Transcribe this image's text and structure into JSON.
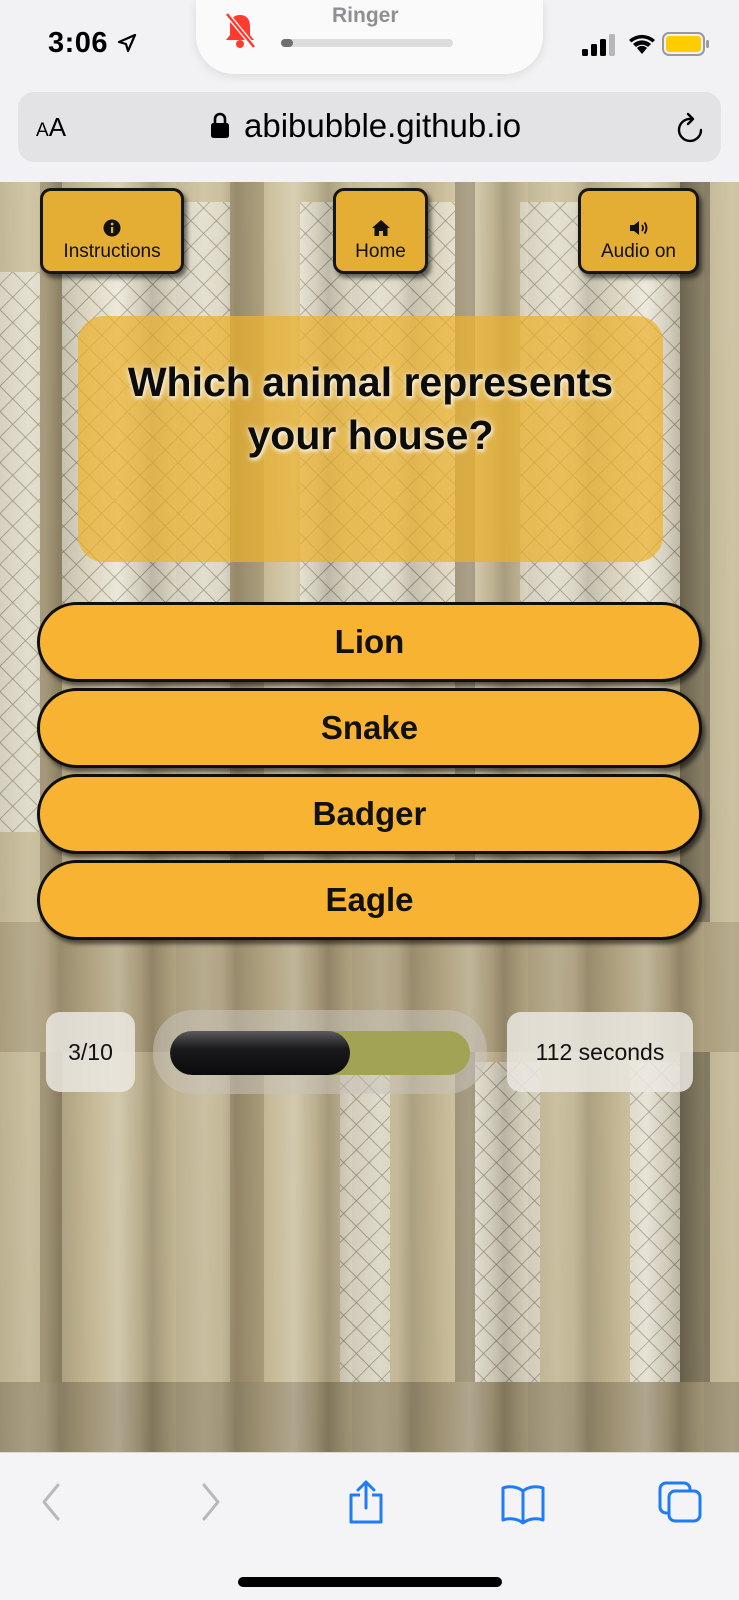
{
  "status_bar": {
    "time": "3:06",
    "ringer_label": "Ringer",
    "ringer_level": 0.07,
    "icons": [
      "location-arrow-icon",
      "bell-muted-icon",
      "signal-icon",
      "wifi-icon",
      "battery-icon"
    ]
  },
  "address_bar": {
    "text_size_label_small": "A",
    "text_size_label_large": "A",
    "url": "abibubble.github.io"
  },
  "nav": {
    "instructions_label": "Instructions",
    "home_label": "Home",
    "audio_label": "Audio on"
  },
  "quiz": {
    "question": "Which animal represents your house?",
    "answers": [
      "Lion",
      "Snake",
      "Badger",
      "Eagle"
    ],
    "counter": "3/10",
    "progress_fraction": 0.6,
    "timer": "112 seconds"
  },
  "colors": {
    "button": "#f7b331",
    "nav_button": "#e4ad33",
    "question_box": "#ecb22c",
    "progress_track": "#a3a355",
    "progress_fill": "#0b0b0d"
  },
  "toolbar": {
    "icons": [
      "back-icon",
      "forward-icon",
      "share-icon",
      "bookmarks-icon",
      "tabs-icon"
    ]
  }
}
